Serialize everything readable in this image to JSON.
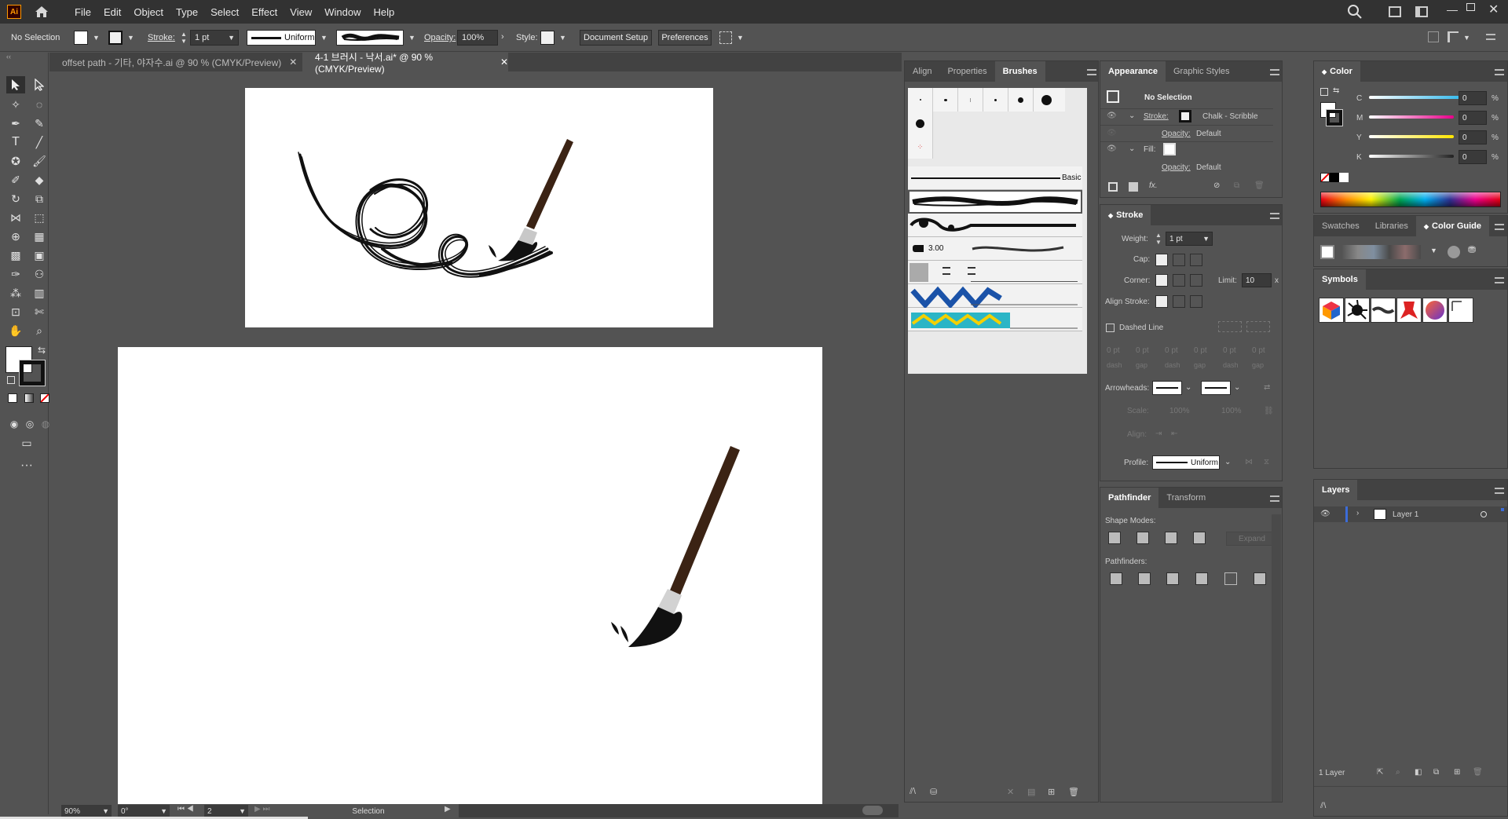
{
  "menubar": {
    "logo": "Ai",
    "items": [
      "File",
      "Edit",
      "Object",
      "Type",
      "Select",
      "Effect",
      "View",
      "Window",
      "Help"
    ]
  },
  "controlbar": {
    "selection": "No Selection",
    "stroke_label": "Stroke:",
    "stroke_weight": "1 pt",
    "profile": "Uniform",
    "opacity_label": "Opacity:",
    "opacity": "100%",
    "style_label": "Style:",
    "document_setup": "Document Setup",
    "preferences": "Preferences"
  },
  "tabs": [
    {
      "label": "offset path - 기타, 야자수.ai @ 90 % (CMYK/Preview)",
      "active": false
    },
    {
      "label": "4-1 브러시 - 낙서.ai* @ 90 % (CMYK/Preview)",
      "active": true
    }
  ],
  "status": {
    "zoom": "90%",
    "rotation": "0°",
    "artboard": "2",
    "tool": "Selection"
  },
  "brushes_panel": {
    "tabs": [
      "Align",
      "Properties",
      "Brushes"
    ],
    "basic_label": "Basic",
    "scatter_value": "3.00"
  },
  "appearance_panel": {
    "tabs": [
      "Appearance",
      "Graphic Styles"
    ],
    "title": "No Selection",
    "stroke_label": "Stroke:",
    "stroke_brush": "Chalk - Scribble",
    "opacity1_label": "Opacity:",
    "opacity1_value": "Default",
    "fill_label": "Fill:",
    "opacity2_label": "Opacity:",
    "opacity2_value": "Default",
    "fx": "fx."
  },
  "stroke_panel": {
    "title": "Stroke",
    "weight_label": "Weight:",
    "weight_value": "1 pt",
    "cap_label": "Cap:",
    "corner_label": "Corner:",
    "limit_label": "Limit:",
    "limit_value": "10",
    "limit_unit": "x",
    "align_label": "Align Stroke:",
    "dashed_label": "Dashed Line",
    "dash_fields": [
      "0 pt",
      "0 pt",
      "0 pt",
      "0 pt",
      "0 pt",
      "0 pt"
    ],
    "dash_labels": [
      "dash",
      "gap",
      "dash",
      "gap",
      "dash",
      "gap"
    ],
    "arrowheads_label": "Arrowheads:",
    "scale_label": "Scale:",
    "scale1": "100%",
    "scale2": "100%",
    "align2_label": "Align:",
    "profile_label": "Profile:",
    "profile_value": "Uniform"
  },
  "pathfinder_panel": {
    "tabs": [
      "Pathfinder",
      "Transform"
    ],
    "shape_modes": "Shape Modes:",
    "expand": "Expand",
    "pathfinders": "Pathfinders:"
  },
  "color_panel": {
    "title": "Color",
    "channels": [
      {
        "label": "C",
        "value": "0",
        "unit": "%",
        "color": "#00a8e8"
      },
      {
        "label": "M",
        "value": "0",
        "unit": "%",
        "color": "#e8008a"
      },
      {
        "label": "Y",
        "value": "0",
        "unit": "%",
        "color": "#ffe600"
      },
      {
        "label": "K",
        "value": "0",
        "unit": "%",
        "color": "#222222"
      }
    ]
  },
  "swatches_panel": {
    "tabs": [
      "Swatches",
      "Libraries",
      "Color Guide"
    ]
  },
  "symbols_panel": {
    "title": "Symbols"
  },
  "layers_panel": {
    "title": "Layers",
    "layer_name": "Layer 1",
    "count": "1 Layer"
  },
  "colors": {
    "accent": "#3c6cd8",
    "brush_handle": "#3b2314",
    "brush_ferrule": "#c8c8c8"
  }
}
